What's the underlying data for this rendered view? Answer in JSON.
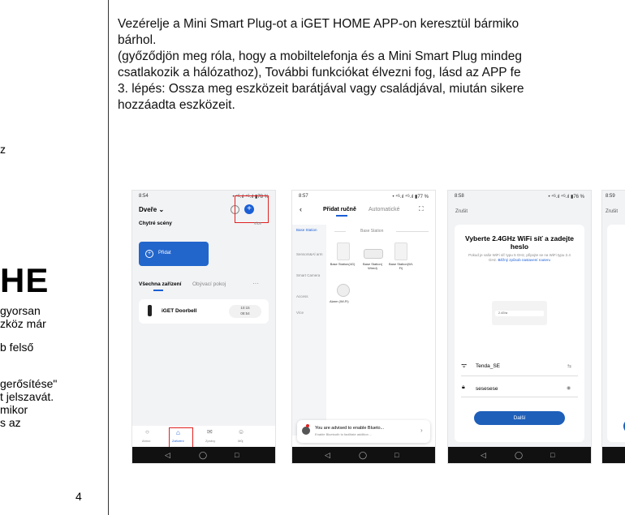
{
  "left_column": {
    "fragments": [
      "z",
      "gyorsan",
      "zköz már",
      "b felső",
      "gerősítése\"",
      "t jelszavát.",
      "mikor",
      "s az"
    ],
    "big_word": "HE",
    "page_number": "4"
  },
  "main_text": [
    "Vezérelje a Mini Smart Plug-ot a iGET HOME APP-on keresztül bármiko",
    "bárhol.",
    "(győződjön meg róla, hogy a mobiltelefonja és a Mini Smart Plug mindeg",
    "csatlakozik a hálózathoz), További funkciókat élvezni fog, lásd az APP fe",
    "3. lépés: Ossza meg eszközeit barátjával vagy családjával, miután sikere",
    "hozzáadta eszközeit."
  ],
  "phone1": {
    "time": "8:54",
    "status": "• ⁴ᴳ.ıl ⁴ᴳ.ıl ▮78 %",
    "home_title": "Dveře ⌄",
    "section_scenes": "Chytré scény",
    "section_more": "více",
    "add_scene_label": "Přidat",
    "tab_all": "Všechna zařízení",
    "tab_room": "Obývací pokoj",
    "tab_more": "···",
    "device_name": "iGET Doorbell",
    "device_time": "10:15\n08:54",
    "nav": [
      "Ahnoí",
      "Zařízení",
      "Zprávy",
      "Můj"
    ]
  },
  "phone2": {
    "time": "8:57",
    "status": "• ⁴ᴳ.ıl ⁴ᴳ.ıl ▮77 %",
    "tab_manual": "Přidat ručně",
    "tab_auto": "Automatické",
    "categories": [
      "Base Station",
      "Sensors&Al arm",
      "Smart Camera",
      "Access",
      "Více"
    ],
    "group_title": "Base Station",
    "items": [
      "Base Station(4G)",
      "Base Station( Wired)",
      "Base Station(Wi-Fi)",
      "Alarm (Wi-Fi)"
    ],
    "bt_title": "You are advised to enable Blueto...",
    "bt_sub": "Enable Bluetooth to facilitate addition ..."
  },
  "phone3": {
    "time": "8:58",
    "status": "• ⁴ᴳ.ıl ⁴ᴳ.ıl ▮76 %",
    "cancel": "Zrušit",
    "title": "Vyberte 2.4GHz WiFi síť a zadejte heslo",
    "desc": "Pokud je vaše WiFi síť typu 5 GHz, připojte se na WiFi typu 2.4 GHz.",
    "desc_link": "Běžný způsob nastavení routeru",
    "wifi_name": "Tenda_SE",
    "password": "sesesese",
    "next": "Další",
    "mini_wifi": "2.4Ghz"
  },
  "phone4": {
    "time": "8:59",
    "cancel": "Zrušit"
  }
}
